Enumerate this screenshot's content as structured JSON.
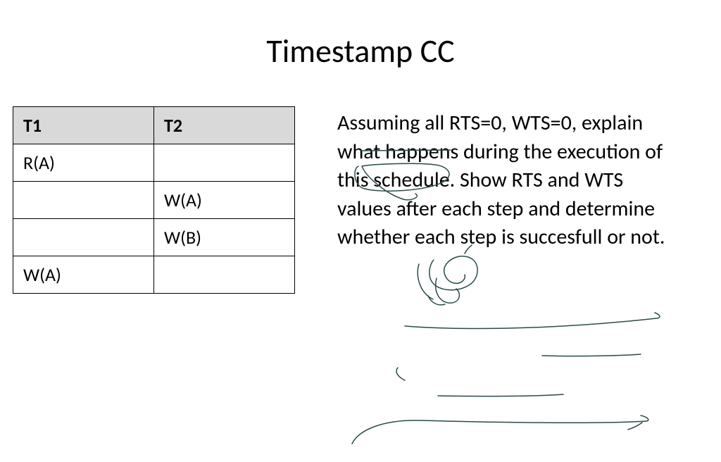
{
  "title": "Timestamp CC",
  "table": {
    "headers": [
      "T1",
      "T2"
    ],
    "rows": [
      [
        "R(A)",
        ""
      ],
      [
        "",
        "W(A)"
      ],
      [
        "",
        "W(B)"
      ],
      [
        "W(A)",
        ""
      ]
    ]
  },
  "explanation": "Assuming all RTS=0, WTS=0, explain what happens during the execution of this schedule. Show RTS and WTS values after each step and determine whether each step is succesfull or not."
}
